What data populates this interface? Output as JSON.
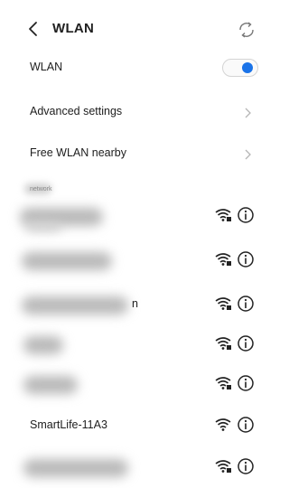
{
  "header": {
    "title": "WLAN"
  },
  "wlan_row": {
    "label": "WLAN",
    "toggle_on": true
  },
  "advanced_row": {
    "label": "Advanced settings"
  },
  "nearby_row": {
    "label": "Free WLAN nearby"
  },
  "section": {
    "label": "network"
  },
  "networks": [
    {
      "name": "",
      "blurred": true,
      "locked": true
    },
    {
      "name": "",
      "blurred": true,
      "locked": true
    },
    {
      "name": "n",
      "blurred": true,
      "locked": true
    },
    {
      "name": "",
      "blurred": true,
      "locked": true
    },
    {
      "name": "",
      "blurred": true,
      "locked": true
    },
    {
      "name": "SmartLife-11A3",
      "blurred": false,
      "locked": false
    },
    {
      "name": "",
      "blurred": true,
      "locked": true
    }
  ],
  "colors": {
    "accent": "#1a73e8",
    "text": "#202020",
    "muted": "#8a8a8a"
  }
}
